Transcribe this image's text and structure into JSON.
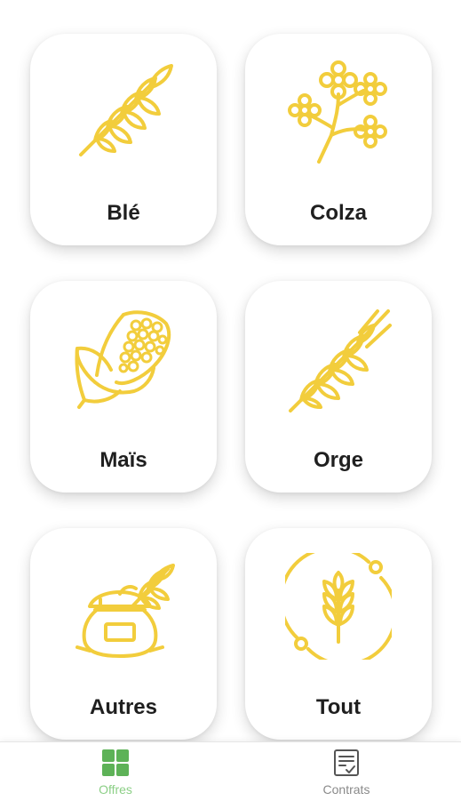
{
  "colors": {
    "icon_yellow": "#f2cd3c",
    "active_green": "#5db257",
    "inactive_gray": "#555555"
  },
  "categories": [
    {
      "label": "Blé",
      "icon": "wheat-icon"
    },
    {
      "label": "Colza",
      "icon": "rapeseed-flower-icon"
    },
    {
      "label": "Maïs",
      "icon": "corn-icon"
    },
    {
      "label": "Orge",
      "icon": "barley-icon"
    },
    {
      "label": "Autres",
      "icon": "grain-sack-icon"
    },
    {
      "label": "Tout",
      "icon": "all-crops-icon"
    }
  ],
  "bottom_nav": {
    "items": [
      {
        "label": "Offres",
        "icon": "grid-icon",
        "active": true
      },
      {
        "label": "Contrats",
        "icon": "contract-icon",
        "active": false
      }
    ]
  }
}
